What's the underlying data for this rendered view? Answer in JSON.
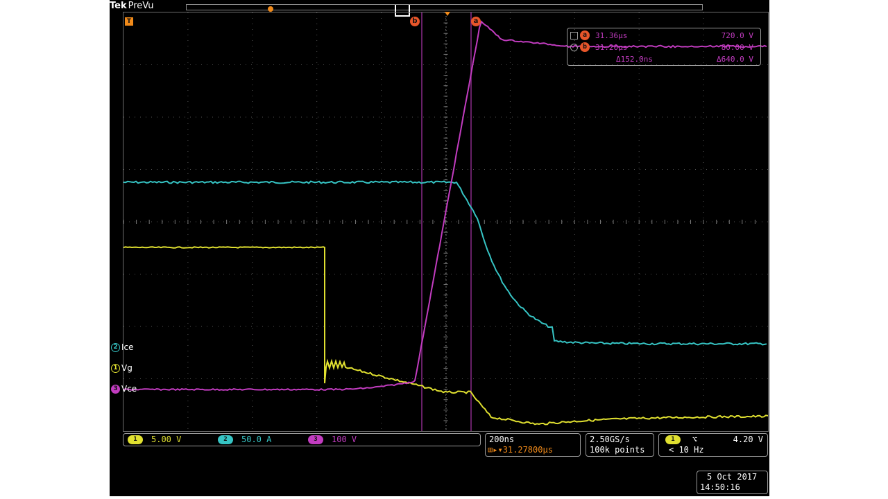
{
  "header": {
    "brand": "Tek",
    "mode": "PreVu"
  },
  "cursors": {
    "a_label": "a",
    "b_label": "b",
    "trigger_label": "T"
  },
  "readout": {
    "a_time": "31.36µs",
    "a_value": "720.0 V",
    "b_time": "31.20µs",
    "b_value": "80.00 V",
    "delta_time": "Δ152.0ns",
    "delta_value": "Δ640.0 V"
  },
  "channels": [
    {
      "num": "2",
      "name": "Ice",
      "color": "#36c4c4"
    },
    {
      "num": "1",
      "name": "Vg",
      "color": "#e0e030"
    },
    {
      "num": "3",
      "name": "Vce",
      "color": "#c23cc0"
    }
  ],
  "scales": {
    "ch1": "5.00 V",
    "ch2": "50.0 A",
    "ch3": "100 V",
    "ch1_num": "1",
    "ch2_num": "2",
    "ch3_num": "3"
  },
  "timebase": {
    "per_div": "200ns",
    "position": "31.27800µs",
    "position_prefix": "⊞▸▾"
  },
  "acquisition": {
    "rate": "2.50GS/s",
    "record": "100k points"
  },
  "trigger": {
    "source": "1",
    "slope": "⌥",
    "level": "4.20 V",
    "freq": "< 10 Hz"
  },
  "datetime": {
    "date": "5 Oct  2017",
    "time": "14:50:16"
  },
  "colors": {
    "ch1": "#e0e030",
    "ch2": "#36c4c4",
    "ch3": "#c23cc0",
    "cursor": "#e8562a",
    "trigger": "#f08a1a"
  },
  "chart_data": {
    "type": "line",
    "series": [
      {
        "name": "Ice",
        "color": "#36c4c4"
      },
      {
        "name": "Vg",
        "color": "#e0e030"
      },
      {
        "name": "Vce",
        "color": "#c23cc0"
      }
    ]
  }
}
